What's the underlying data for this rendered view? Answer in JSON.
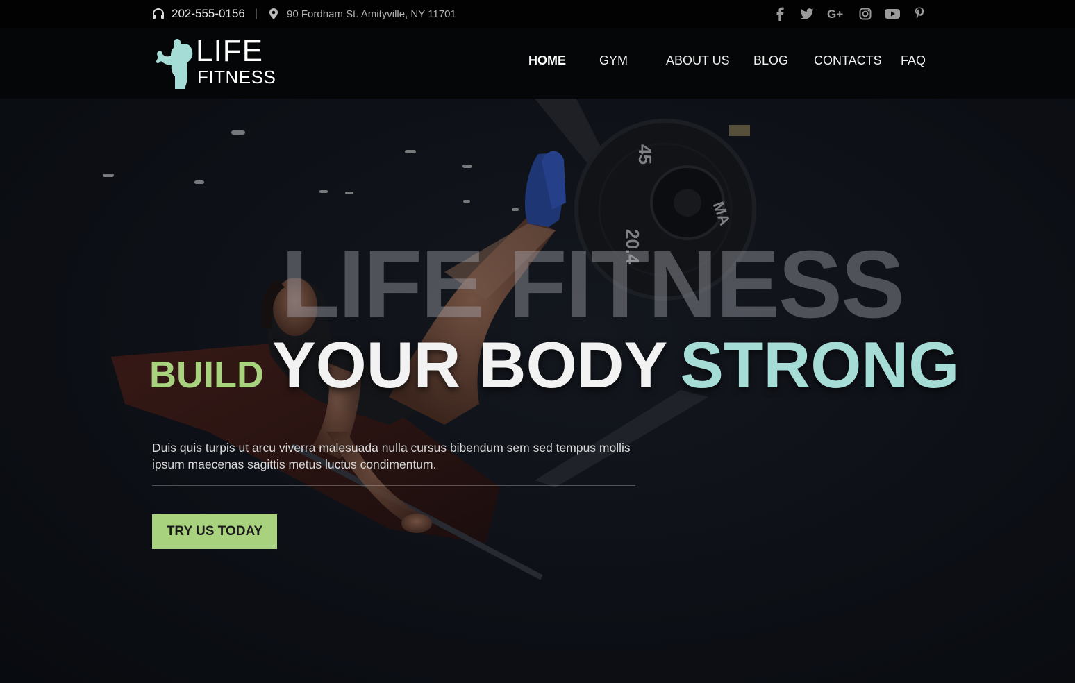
{
  "topbar": {
    "phone": "202-555-0156",
    "separator": "|",
    "address": "90 Fordham St. Amityville, NY 11701",
    "social": [
      {
        "name": "facebook-icon",
        "glyph": "f"
      },
      {
        "name": "twitter-icon",
        "glyph": "t"
      },
      {
        "name": "google-plus-icon",
        "glyph": "G+"
      },
      {
        "name": "instagram-icon",
        "glyph": "ig"
      },
      {
        "name": "youtube-icon",
        "glyph": "yt"
      },
      {
        "name": "pinterest-icon",
        "glyph": "p"
      }
    ]
  },
  "logo": {
    "line1": "LIFE",
    "line2": "FITNESS",
    "color": "#a5dcd6"
  },
  "nav": {
    "items": [
      "HOME",
      "GYM",
      "ABOUT US",
      "BLOG",
      "CONTACTS",
      "FAQ"
    ],
    "active": "HOME"
  },
  "hero": {
    "background_word": "LIFE FITNESS",
    "headline": {
      "word1": "BUILD",
      "word2": "YOUR BODY",
      "word3": "STRONG"
    },
    "description": "Duis quis turpis ut arcu viverra malesuada nulla cursus bibendum sem sed tempus mollis ipsum maecenas sagittis metus luctus condimentum.",
    "cta": "TRY US TODAY",
    "plate_labels": [
      "45",
      "20.4",
      "MA"
    ]
  },
  "colors": {
    "accent_green": "#a8d27e",
    "accent_teal": "#a5dcd6",
    "topbar_bg": "#020202",
    "header_bg": "#050506"
  }
}
